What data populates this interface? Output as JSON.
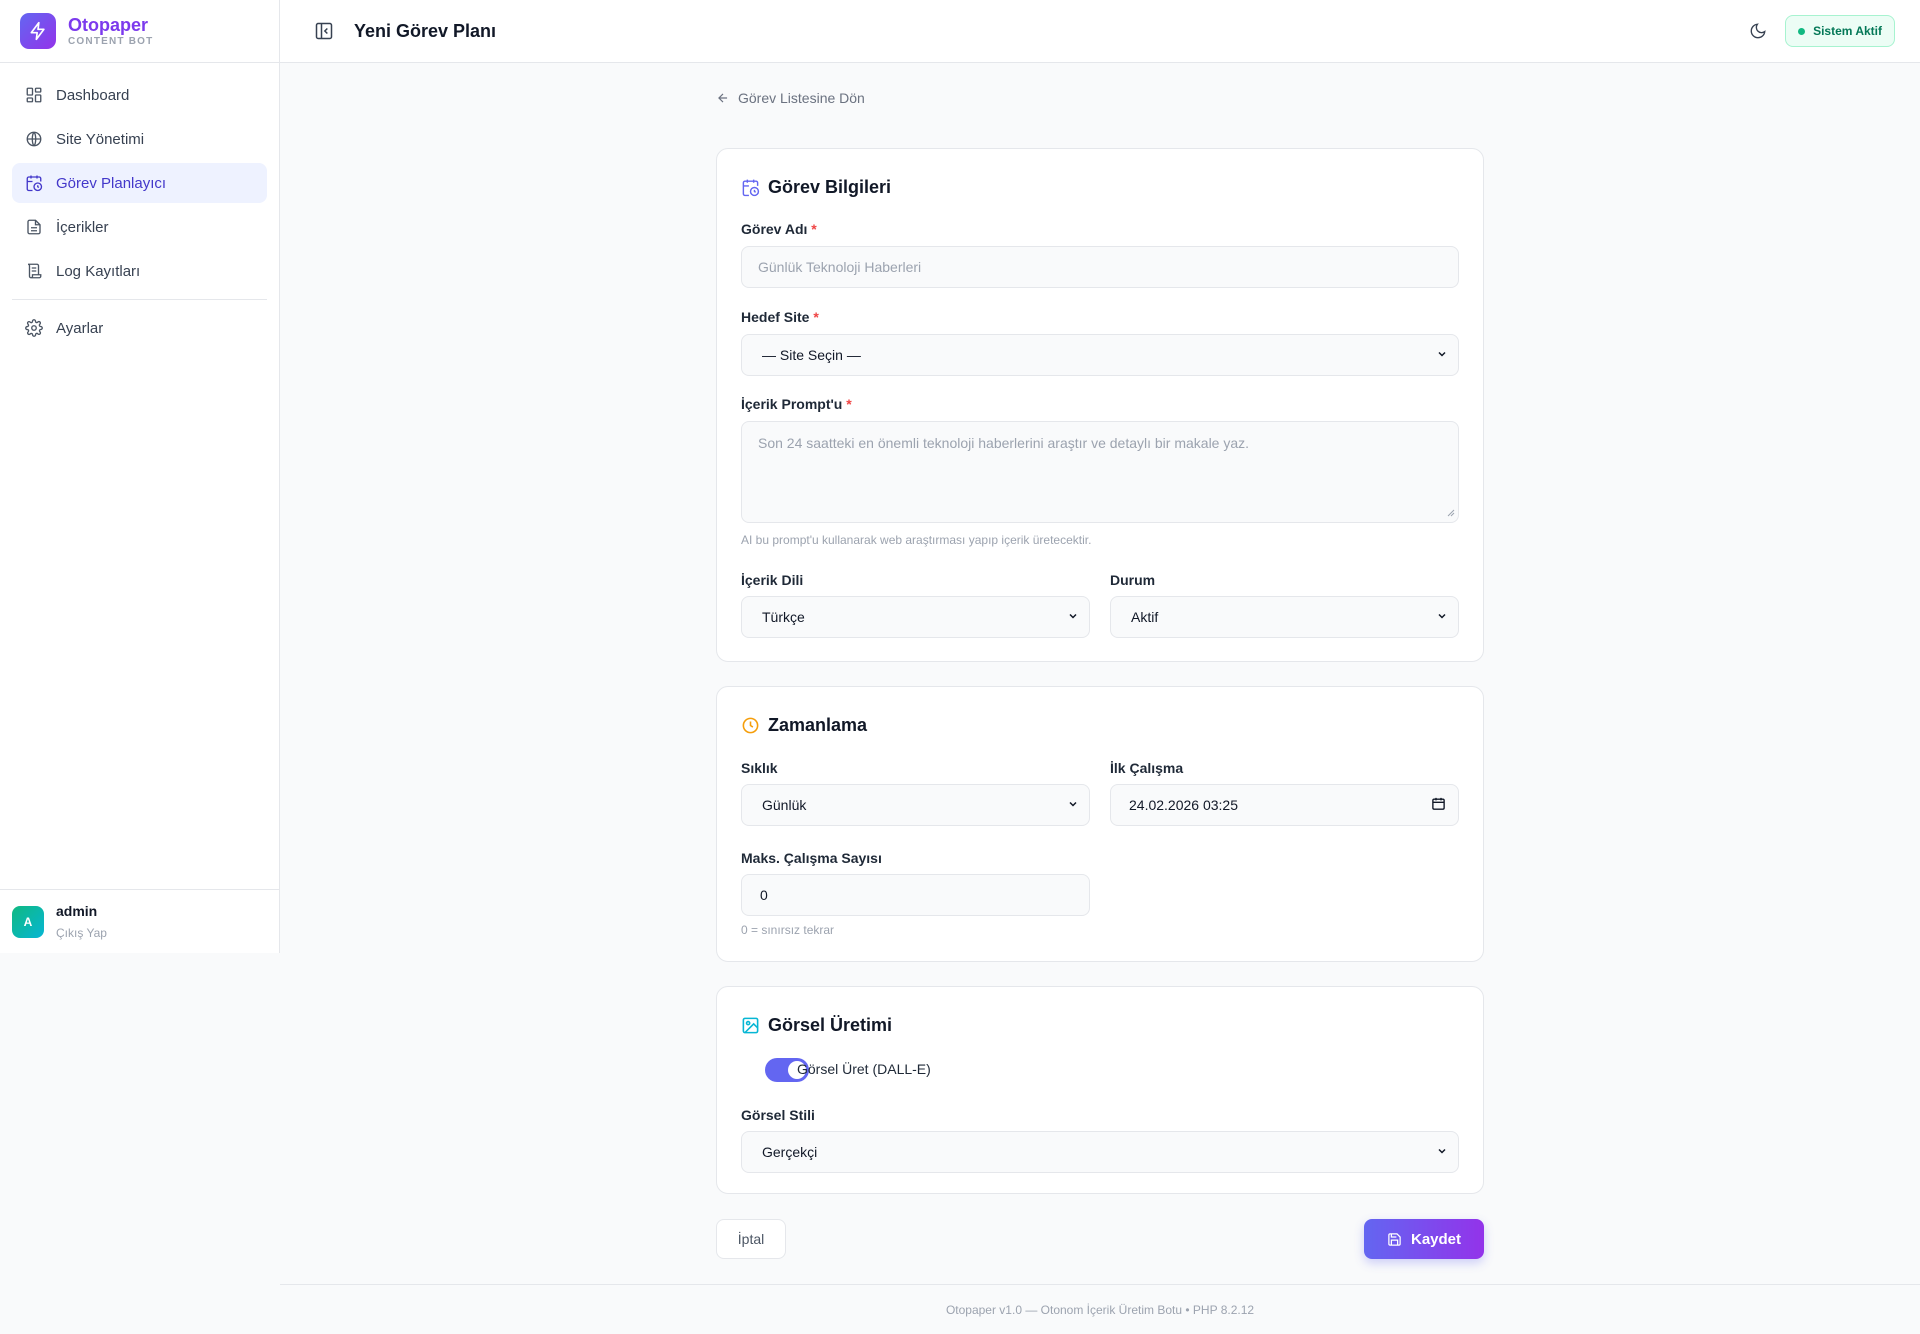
{
  "app": {
    "name": "Otopaper",
    "subtitle": "CONTENT BOT"
  },
  "sidebar": {
    "items": [
      {
        "label": "Dashboard",
        "icon": "dashboard-icon"
      },
      {
        "label": "Site Yönetimi",
        "icon": "globe-icon"
      },
      {
        "label": "Görev Planlayıcı",
        "icon": "calendar-clock-icon",
        "active": true
      },
      {
        "label": "İçerikler",
        "icon": "document-icon"
      },
      {
        "label": "Log Kayıtları",
        "icon": "scroll-icon"
      },
      {
        "label": "Ayarlar",
        "icon": "gear-icon"
      }
    ],
    "user": {
      "initial": "A",
      "name": "admin",
      "logout": "Çıkış Yap"
    }
  },
  "header": {
    "title": "Yeni Görev Planı",
    "status": "Sistem Aktif"
  },
  "main": {
    "back_label": "Görev Listesine Dön",
    "task_info": {
      "title": "Görev Bilgileri",
      "name_label": "Görev Adı",
      "name_placeholder": "Günlük Teknoloji Haberleri",
      "site_label": "Hedef Site",
      "site_value": "— Site Seçin —",
      "prompt_label": "İçerik Prompt'u",
      "prompt_placeholder": "Son 24 saatteki en önemli teknoloji haberlerini araştır ve detaylı bir makale yaz.",
      "prompt_hint": "AI bu prompt'u kullanarak web araştırması yapıp içerik üretecektir.",
      "language_label": "İçerik Dili",
      "language_value": "Türkçe",
      "status_label": "Durum",
      "status_value": "Aktif",
      "required_mark": "*"
    },
    "schedule": {
      "title": "Zamanlama",
      "frequency_label": "Sıklık",
      "frequency_value": "Günlük",
      "first_run_label": "İlk Çalışma",
      "first_run_value": "24.02.2026 03:25",
      "max_runs_label": "Maks. Çalışma Sayısı",
      "max_runs_value": "0",
      "max_runs_hint": "0 = sınırsız tekrar"
    },
    "image": {
      "title": "Görsel Üretimi",
      "toggle_label": "Görsel Üret (DALL-E)",
      "toggle_on": true,
      "style_label": "Görsel Stili",
      "style_value": "Gerçekçi"
    },
    "cancel_label": "İptal",
    "save_label": "Kaydet"
  },
  "footer": {
    "text": "Otopaper v1.0 — Otonom İçerik Üretim Botu • PHP 8.2.12"
  },
  "colors": {
    "accent": "#6366f1",
    "accent2": "#9333ea",
    "success": "#10b981",
    "warning": "#f59e0b",
    "cyan": "#06b6d4"
  }
}
